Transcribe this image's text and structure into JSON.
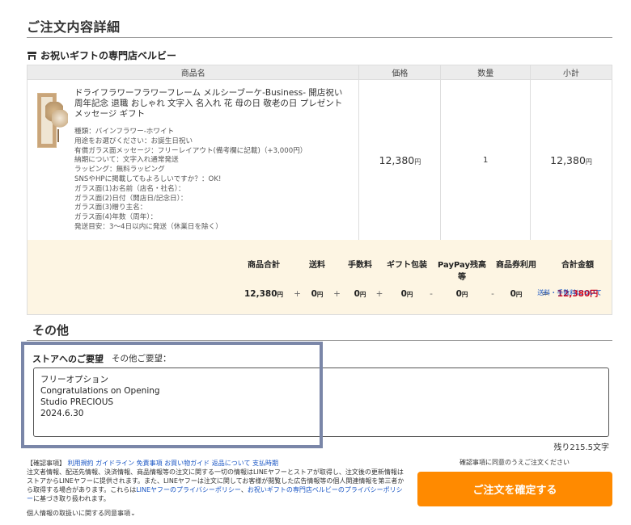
{
  "page": {
    "title": "ご注文内容詳細",
    "shop_name": "お祝いギフトの専門店ベルビー"
  },
  "table": {
    "headers": [
      "商品名",
      "価格",
      "数量",
      "小計"
    ],
    "item": {
      "name": "ドライフラワーフラワーフレーム メルシーブーケ-Business- 開店祝い 周年記念 退職 おしゃれ 文字入 名入れ 花 母の日 敬老の日 プレゼント メッセージ ギフト",
      "options": [
        "種類：バインフラワー-ホワイト",
        "用途をお選びください：お誕生日祝い",
        "有償ガラス面メッセージ：フリーレイアウト(備考欄に記載)（+3,000円）",
        "納期について：文字入れ通常発送",
        "ラッピング：無料ラッピング",
        "SNSやHPに掲載してもよろしいですか？：OK!",
        "ガラス面(1)お名前（店名・社名）：",
        "ガラス面(2)日付（開店日/記念日）：",
        "ガラス面(3)贈り主名：",
        "ガラス面(4)年数（周年）：",
        "発送目安：3～4日以内に発送（休業日を除く）"
      ],
      "price": "12,380",
      "quantity": "1",
      "subtotal": "12,380",
      "yen": "円"
    }
  },
  "summary": {
    "labels": [
      "商品合計",
      "送料",
      "手数料",
      "ギフト包装",
      "PayPay残高等",
      "商品券利用",
      "合計金額"
    ],
    "values": [
      "12,380",
      "0",
      "0",
      "0",
      "0",
      "0",
      "12,380"
    ],
    "ops": [
      "+",
      "+",
      "+",
      "-",
      "-",
      "="
    ],
    "yen": "円",
    "fee_link": "送料・手数料について"
  },
  "other": {
    "title": "その他",
    "request_label": "ストアへのご要望",
    "request_sublabel": "その他ご要望：",
    "request_text": "フリーオプション\nCongratulations on Opening\nStudio PRECIOUS\n2024.6.30",
    "remaining": "残り215.5文字"
  },
  "notes": {
    "heading": "【確認事項】",
    "links": [
      "利用規約",
      "ガイドライン",
      "免責事項",
      "お買い物ガイド",
      "返品について",
      "支払時期"
    ],
    "body1": "注文者情報、配送先情報、決済情報、商品情報等の注文に関する一切の情報はLINEヤフーとストアが取得し、注文後の更新情報はストアからLINEヤフーに提供されます。また、LINEヤフーは注文に関してお客様が閲覧した広告情報等の個人関連情報を第三者から取得する場合があります。これらは",
    "link_policy1": "LINEヤフーのプライバシーポリシー",
    "sep": "、",
    "link_policy2": "お祝いギフトの専門店ベルビーのプライバシーポリシー",
    "body2": "に基づき取り扱われます。",
    "consent": "個人情報の取扱いに関する同意事項⌄"
  },
  "checkout": {
    "agree_text": "確認事項に同意のうえご注文ください",
    "confirm_label": "ご注文を確定する"
  },
  "colors": {
    "accent": "#ff8a00",
    "total_red": "#d0021b",
    "link": "#1a56c4",
    "summary_bg": "#fdf5e3"
  }
}
